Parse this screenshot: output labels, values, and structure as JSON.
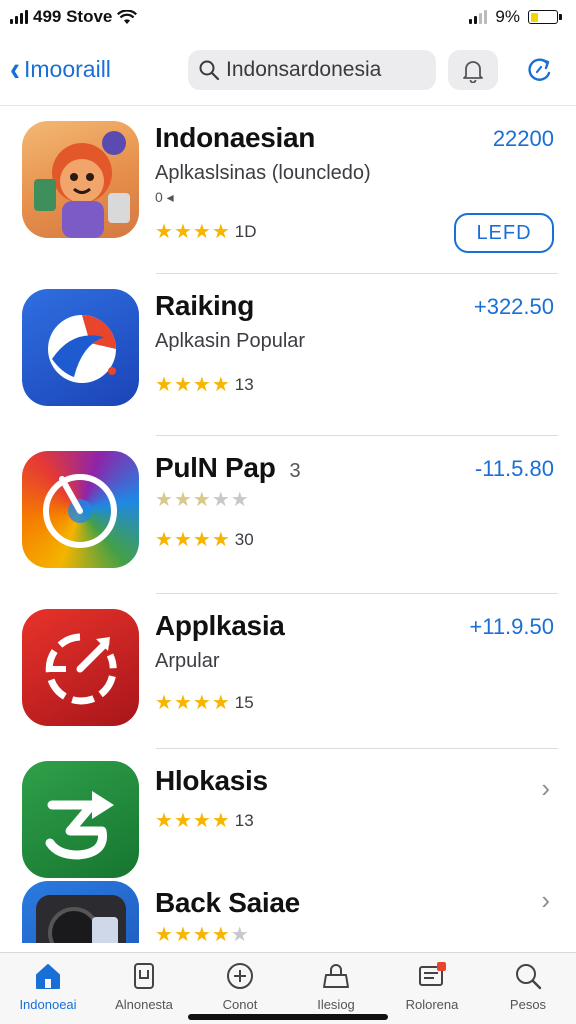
{
  "status": {
    "carrier": "499 Stove",
    "battery": "9%",
    "battery_level": 0.3
  },
  "nav": {
    "back_label": "Imooraill",
    "search_value": "Indonsardonesia"
  },
  "apps": [
    {
      "name": "Indonaesian",
      "subtitle": "Aplkaslsinas (louncledo)",
      "meta": "0 ◂",
      "rating": 4,
      "rating_count": "1D",
      "price": "22200",
      "button": "LEFD",
      "theme": "cartoon"
    },
    {
      "name": "Raiking",
      "subtitle": "Aplkasin Popular",
      "rating": 4,
      "rating_count": "13",
      "price": "+322.50",
      "theme": "blue"
    },
    {
      "name": "PulN Pap",
      "name_extra": "3",
      "rating_secondary": 3,
      "rating": 4,
      "rating_count": "30",
      "price": "-11.5.80",
      "theme": "rainbow"
    },
    {
      "name": "Applkasia",
      "subtitle": "Arpular",
      "rating": 4,
      "rating_count": "15",
      "price": "+11.9.50",
      "theme": "red"
    },
    {
      "name": "Hlokasis",
      "rating": 4,
      "rating_count": "13",
      "chevron": "›",
      "theme": "green"
    },
    {
      "name": "Back Saiae",
      "rating": 4,
      "chevron": "›",
      "theme": "camera"
    }
  ],
  "tabs": [
    {
      "label": "Indonoeai",
      "icon": "home-icon",
      "active": true
    },
    {
      "label": "Alnonesta",
      "icon": "phone-icon"
    },
    {
      "label": "Conot",
      "icon": "plus-circle-icon"
    },
    {
      "label": "Ilesiog",
      "icon": "lock-icon"
    },
    {
      "label": "Rolorena",
      "icon": "mail-icon"
    },
    {
      "label": "Pesos",
      "icon": "search-icon"
    }
  ],
  "colors": {
    "accent": "#1a6fd6",
    "star": "#f7b500",
    "badge": "#e8452c"
  }
}
